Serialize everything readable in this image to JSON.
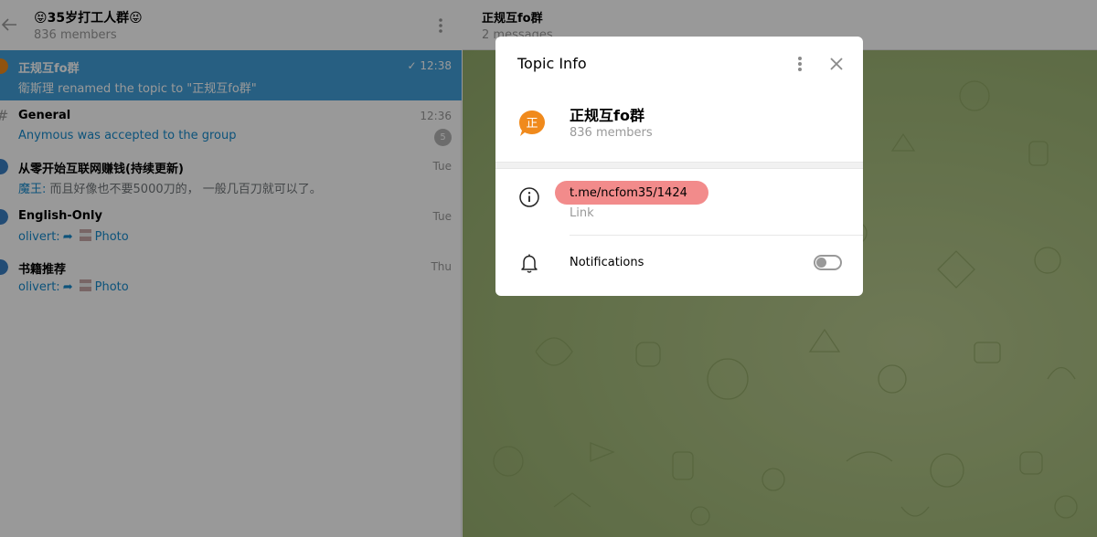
{
  "left_header": {
    "title": "😝35岁打工人群😝",
    "members": "836 members"
  },
  "chats": [
    {
      "name": "正规互fo群",
      "time": "12:38",
      "check": "✓",
      "preview": "衛斯理 renamed the topic to \"正规互fo群\"",
      "active": true
    },
    {
      "name": "General",
      "time": "12:36",
      "preview": "Anymous was accepted to the group",
      "badge": "5"
    },
    {
      "name": "从零开始互联网赚钱(持续更新)",
      "time": "Tue",
      "sender": "魔王:",
      "preview": "而且好像也不要5000刀的， 一般几百刀就可以了。"
    },
    {
      "name": "English-Only",
      "time": "Tue",
      "sender": "olivert:",
      "preview": "Photo"
    },
    {
      "name": "书籍推荐",
      "time": "Thu",
      "sender": "olivert:",
      "preview": "Photo"
    }
  ],
  "right_header": {
    "title": "正规互fo群",
    "subtitle": "2 messages"
  },
  "modal": {
    "title": "Topic Info",
    "topic_name": "正规互fo群",
    "topic_members": "836 members",
    "avatar_char": "正",
    "link": "t.me/ncfom35/1424",
    "link_caption": "Link",
    "notifications_label": "Notifications",
    "notifications_enabled": false
  },
  "colors": {
    "accent": "#419fd9",
    "link_blue": "#168acd",
    "avatar_orange": "#f08a1c",
    "link_highlight": "#f28b8b"
  }
}
